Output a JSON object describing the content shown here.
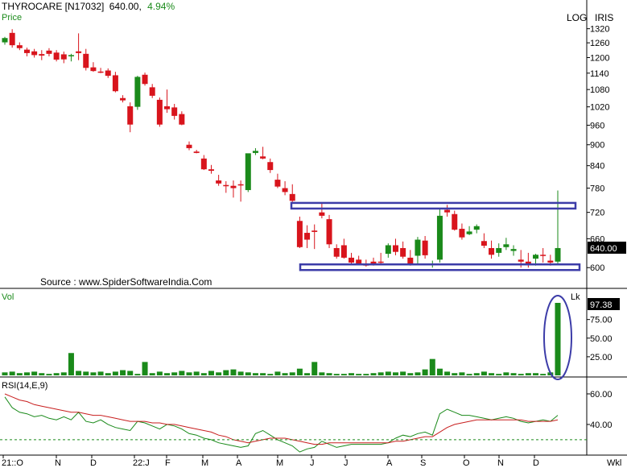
{
  "header": {
    "symbol": "THYROCARE [N17032]",
    "price": "640.00,",
    "change": "4.94%",
    "panel_price": "Price",
    "log_label": "LOG",
    "iris_label": "IRIS",
    "source": "Source : www.SpiderSoftwareIndia.Com"
  },
  "colors": {
    "up": "#1a8a1a",
    "down": "#d8141c",
    "box": "#3c3ca8",
    "rsi_line": "#1a8a1a",
    "rsi_signal": "#c81e1e"
  },
  "chart_data": [
    {
      "type": "candlestick",
      "panel": "Price",
      "scale": "log",
      "yticks": [
        "1320",
        "1260",
        "1200",
        "1140",
        "1080",
        "1020",
        "960",
        "900",
        "840",
        "780",
        "720",
        "660",
        "600"
      ],
      "last_value_label": "640.00",
      "candles": [
        [
          1262,
          1285,
          1252,
          1280
        ],
        [
          1302,
          1318,
          1240,
          1250
        ],
        [
          1250,
          1262,
          1230,
          1238
        ],
        [
          1232,
          1240,
          1205,
          1218
        ],
        [
          1225,
          1235,
          1200,
          1210
        ],
        [
          1214,
          1230,
          1190,
          1208
        ],
        [
          1228,
          1238,
          1205,
          1215
        ],
        [
          1220,
          1230,
          1185,
          1192
        ],
        [
          1213,
          1224,
          1178,
          1193
        ],
        [
          1205,
          1215,
          1185,
          1210
        ],
        [
          1225,
          1300,
          1190,
          1218
        ],
        [
          1215,
          1235,
          1150,
          1160
        ],
        [
          1162,
          1182,
          1145,
          1148
        ],
        [
          1146,
          1160,
          1140,
          1145
        ],
        [
          1150,
          1158,
          1122,
          1130
        ],
        [
          1132,
          1145,
          1070,
          1074
        ],
        [
          1050,
          1060,
          1035,
          1042
        ],
        [
          1022,
          1035,
          938,
          962
        ],
        [
          1020,
          1130,
          1010,
          1126
        ],
        [
          1134,
          1142,
          1094,
          1100
        ],
        [
          1088,
          1100,
          1050,
          1058
        ],
        [
          1044,
          1052,
          955,
          962
        ],
        [
          1022,
          1080,
          1000,
          1012
        ],
        [
          1018,
          1030,
          978,
          990
        ],
        [
          996,
          1005,
          960,
          962
        ],
        [
          900,
          910,
          884,
          890
        ],
        [
          880,
          885,
          875,
          876
        ],
        [
          860,
          870,
          828,
          830
        ],
        [
          830,
          842,
          818,
          826
        ],
        [
          800,
          815,
          786,
          792
        ],
        [
          788,
          798,
          768,
          785
        ],
        [
          786,
          800,
          756,
          780
        ],
        [
          790,
          800,
          746,
          788
        ],
        [
          775,
          830,
          770,
          875
        ],
        [
          876,
          890,
          870,
          882
        ],
        [
          866,
          894,
          858,
          860
        ],
        [
          850,
          860,
          820,
          828
        ],
        [
          802,
          818,
          780,
          784
        ],
        [
          780,
          798,
          762,
          770
        ],
        [
          765,
          790,
          745,
          748
        ],
        [
          700,
          710,
          640,
          642
        ],
        [
          673,
          690,
          640,
          658
        ],
        [
          678,
          692,
          638,
          675
        ],
        [
          720,
          744,
          706,
          712
        ],
        [
          704,
          714,
          640,
          648
        ],
        [
          640,
          648,
          618,
          622
        ],
        [
          646,
          660,
          618,
          620
        ],
        [
          620,
          630,
          606,
          610
        ],
        [
          616,
          624,
          606,
          608
        ],
        [
          608,
          616,
          602,
          604
        ],
        [
          612,
          620,
          604,
          608
        ],
        [
          612,
          630,
          606,
          610
        ],
        [
          628,
          650,
          620,
          646
        ],
        [
          646,
          660,
          625,
          632
        ],
        [
          640,
          654,
          618,
          622
        ],
        [
          620,
          636,
          604,
          606
        ],
        [
          624,
          664,
          608,
          658
        ],
        [
          656,
          666,
          618,
          625
        ],
        [
          605,
          614,
          600,
          608
        ],
        [
          616,
          728,
          610,
          712
        ],
        [
          726,
          738,
          710,
          720
        ],
        [
          716,
          724,
          678,
          680
        ],
        [
          682,
          694,
          658,
          663
        ],
        [
          670,
          688,
          668,
          676
        ],
        [
          680,
          692,
          672,
          688
        ],
        [
          655,
          672,
          640,
          645
        ],
        [
          640,
          656,
          618,
          626
        ],
        [
          630,
          650,
          622,
          640
        ],
        [
          642,
          662,
          636,
          648
        ],
        [
          634,
          646,
          624,
          638
        ],
        [
          616,
          636,
          600,
          612
        ],
        [
          612,
          630,
          600,
          606
        ],
        [
          618,
          628,
          604,
          626
        ],
        [
          626,
          640,
          610,
          625
        ],
        [
          614,
          626,
          604,
          610
        ],
        [
          612,
          774,
          606,
          640
        ]
      ],
      "annotations": [
        "horizontal resistance box near 735",
        "horizontal support box near 600"
      ]
    },
    {
      "type": "bar",
      "panel": "Vol",
      "unit": "Lk",
      "yticks": [
        "75.00",
        "50.00",
        "25.00"
      ],
      "last_value_label": "97.38",
      "ylim": [
        0,
        110
      ],
      "values": [
        4,
        5,
        3,
        4,
        5,
        3,
        2,
        3,
        4,
        30,
        6,
        5,
        4,
        5,
        3,
        5,
        7,
        6,
        2,
        18,
        3,
        5,
        3,
        4,
        6,
        4,
        5,
        3,
        6,
        4,
        7,
        8,
        5,
        4,
        3,
        3,
        2,
        5,
        3,
        4,
        9,
        3,
        18,
        4,
        3,
        2,
        2,
        3,
        2,
        2,
        3,
        4,
        5,
        4,
        5,
        3,
        4,
        8,
        22,
        9,
        5,
        3,
        4,
        2,
        3,
        5,
        3,
        2,
        4,
        3,
        2,
        3,
        3,
        2,
        4,
        97.38
      ],
      "annotations": [
        "ellipse highlighting final volume spike"
      ]
    },
    {
      "type": "line",
      "panel": "RSI(14,E,9)",
      "yticks": [
        "60.00",
        "40.00"
      ],
      "ylim": [
        21,
        70
      ],
      "series": [
        {
          "values": [
            58,
            51,
            48,
            47,
            45,
            46,
            44,
            43,
            45,
            43,
            48,
            42,
            41,
            43,
            40,
            38,
            37,
            36,
            42,
            41,
            39,
            37,
            40,
            39,
            37,
            34,
            33,
            31,
            30,
            28,
            27,
            26,
            25,
            26,
            34,
            36,
            33,
            30,
            28,
            26,
            22,
            24,
            25,
            29,
            27,
            25,
            26,
            27,
            27,
            27,
            27,
            27,
            28,
            31,
            33,
            32,
            34,
            35,
            33,
            47,
            50,
            48,
            46,
            46,
            45,
            44,
            43,
            44,
            45,
            44,
            42,
            41,
            42,
            43,
            42,
            46
          ]
        },
        {
          "values": [
            60,
            58,
            56,
            55,
            53,
            52,
            51,
            50,
            49,
            48,
            48,
            47,
            46,
            46,
            45,
            44,
            43,
            42,
            42,
            42,
            41,
            41,
            40,
            40,
            39,
            38,
            37,
            36,
            35,
            33,
            32,
            30,
            29,
            28,
            29,
            30,
            31,
            31,
            31,
            30,
            29,
            28,
            27,
            27,
            28,
            28,
            28,
            28,
            28,
            28,
            28,
            28,
            28,
            29,
            29,
            30,
            31,
            32,
            32,
            35,
            38,
            40,
            41,
            42,
            43,
            43,
            43,
            43,
            43,
            43,
            43,
            42,
            42,
            42,
            42,
            43
          ]
        }
      ],
      "reference_line": 30
    }
  ],
  "time_axis": [
    "21::O",
    "N",
    "D",
    "22:J",
    "F",
    "M",
    "A",
    "M",
    "J",
    "J",
    "A",
    "S",
    "O",
    "N",
    "D",
    "Wkl"
  ]
}
